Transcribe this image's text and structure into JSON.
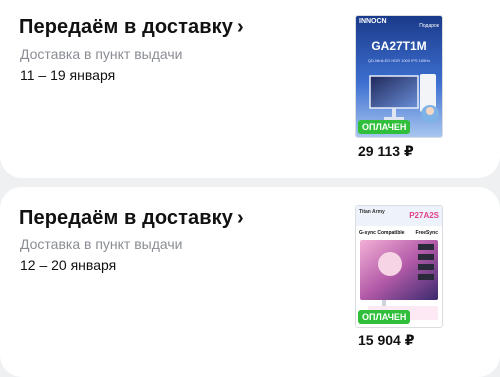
{
  "orders": [
    {
      "status": "Передаём в доставку",
      "chevron": "›",
      "method": "Доставка в пункт выдачи",
      "dates": "11 – 19 января",
      "product": {
        "brand": "INNOCN",
        "model": "GA27T1M",
        "top_tag": "Подарок",
        "specs": "QD-MiniLED  HDR 1000  IPS  165Hz",
        "badge": "ОПЛАЧЕН",
        "price": "29 113 ₽"
      }
    },
    {
      "status": "Передаём в доставку",
      "chevron": "›",
      "method": "Доставка в пункт выдачи",
      "dates": "12 – 20 января",
      "product": {
        "brand": "Titan Army",
        "model": "P27A2S",
        "spec_left": "G-sync Compatible",
        "spec_right": "FreeSync",
        "badge": "ОПЛАЧЕН",
        "price": "15 904 ₽"
      }
    }
  ],
  "colors": {
    "background": "#eef0f2",
    "card": "#ffffff",
    "paid_badge": "#2fbf3a",
    "muted_text": "#8a8d93"
  }
}
